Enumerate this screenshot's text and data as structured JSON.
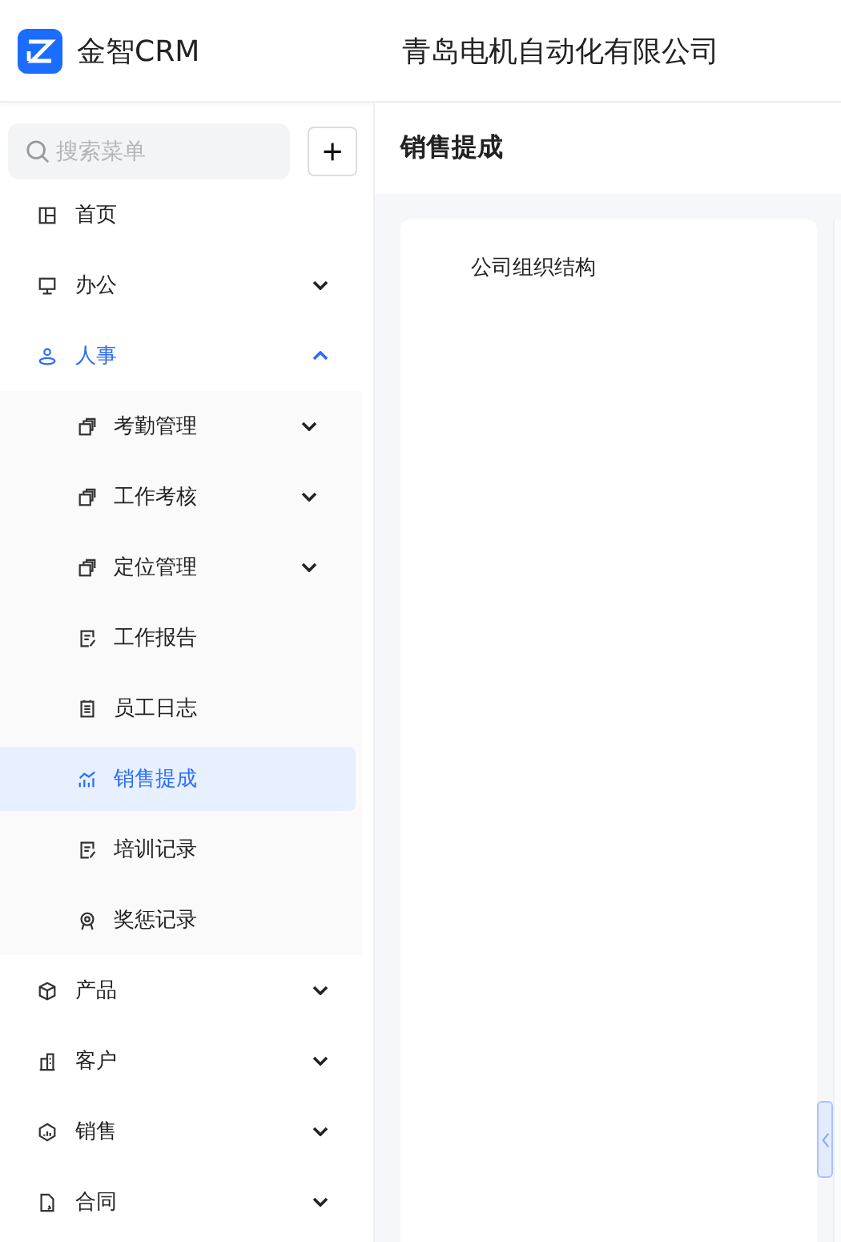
{
  "header": {
    "app_name": "金智CRM",
    "company": "青岛电机自动化有限公司"
  },
  "sidebar": {
    "search": {
      "placeholder": "搜索菜单"
    },
    "add_button": "+",
    "items": [
      {
        "label": "首页",
        "selected": false
      },
      {
        "label": "办公",
        "selected": false,
        "expanded": false
      },
      {
        "label": "人事",
        "selected": true,
        "expanded": true,
        "children": [
          {
            "label": "考勤管理",
            "selected": false,
            "expanded": false
          },
          {
            "label": "工作考核",
            "selected": false,
            "expanded": false
          },
          {
            "label": "定位管理",
            "selected": false,
            "expanded": false
          },
          {
            "label": "工作报告",
            "selected": false
          },
          {
            "label": "员工日志",
            "selected": false
          },
          {
            "label": "销售提成",
            "selected": true
          },
          {
            "label": "培训记录",
            "selected": false
          },
          {
            "label": "奖惩记录",
            "selected": false
          }
        ]
      },
      {
        "label": "产品",
        "selected": false,
        "expanded": false
      },
      {
        "label": "客户",
        "selected": false,
        "expanded": false
      },
      {
        "label": "销售",
        "selected": false,
        "expanded": false
      },
      {
        "label": "合同",
        "selected": false,
        "expanded": false
      }
    ]
  },
  "page": {
    "title": "销售提成",
    "org_panel": {
      "title": "公司组织结构"
    }
  }
}
